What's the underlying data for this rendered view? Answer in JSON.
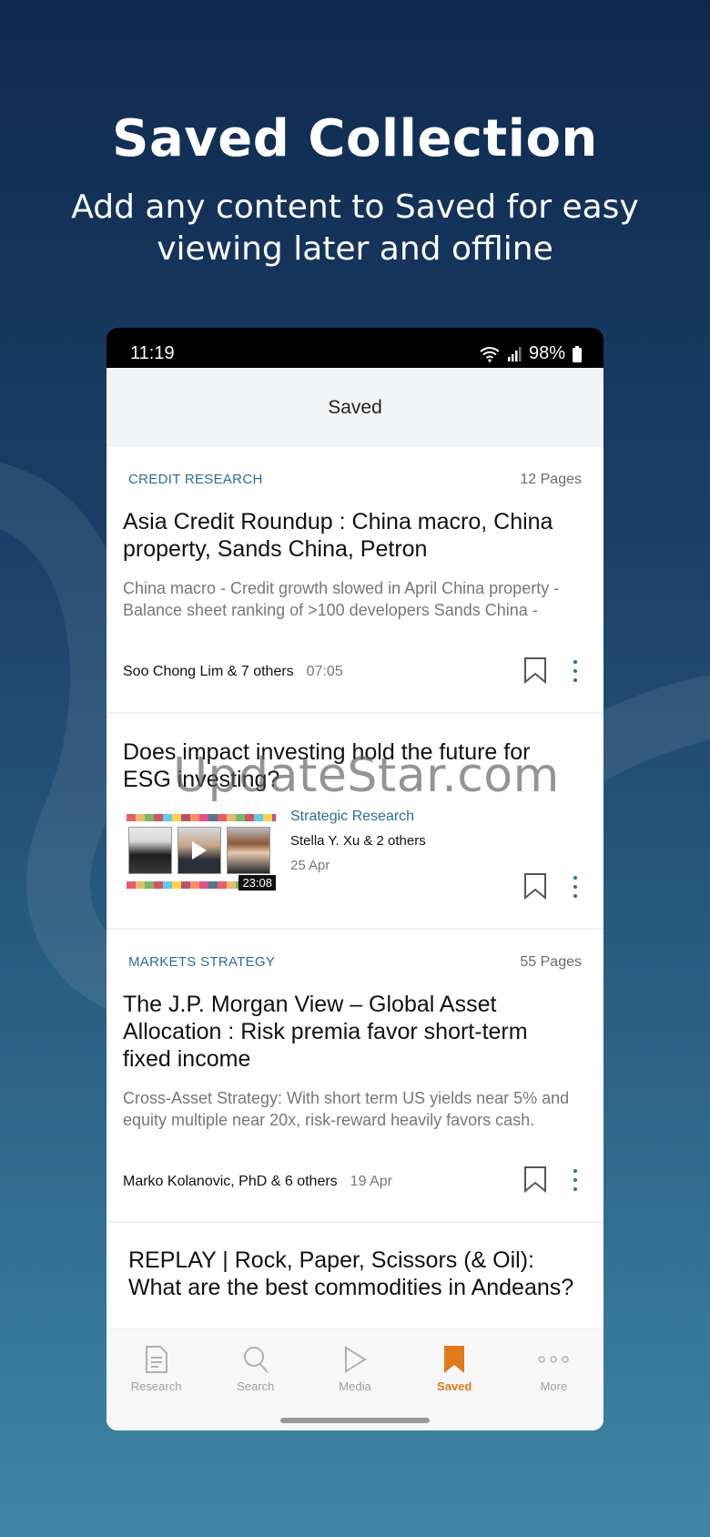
{
  "promo": {
    "title": "Saved Collection",
    "subtitle": "Add any content to Saved for easy viewing later and offline"
  },
  "status": {
    "time": "11:19",
    "battery": "98%"
  },
  "header": {
    "title": "Saved"
  },
  "items": [
    {
      "tag": "CREDIT RESEARCH",
      "pages": "12 Pages",
      "title": "Asia Credit Roundup : China macro, China property, Sands China, Petron",
      "excerpt": "China macro - Credit growth slowed in April China property - Balance sheet ranking of >100 developers Sands China -",
      "author": "Soo Chong Lim & 7 others",
      "date": "07:05"
    },
    {
      "title": "Does impact investing hold the future for ESG investing?",
      "category": "Strategic Research",
      "author": "Stella Y. Xu & 2 others",
      "date": "25 Apr",
      "duration": "23:08"
    },
    {
      "tag": "MARKETS STRATEGY",
      "pages": "55 Pages",
      "title": "The J.P. Morgan View – Global Asset Allocation : Risk premia favor short-term fixed income",
      "excerpt": "Cross-Asset Strategy: With short term US yields near 5% and equity multiple near 20x, risk-reward heavily favors cash.",
      "author": "Marko Kolanovic, PhD & 6 others",
      "date": "19 Apr"
    },
    {
      "title": "REPLAY | Rock, Paper, Scissors (& Oil): What are the best commodities in Andeans?"
    }
  ],
  "tabs": [
    {
      "label": "Research",
      "icon": "document-icon"
    },
    {
      "label": "Search",
      "icon": "search-icon"
    },
    {
      "label": "Media",
      "icon": "play-icon"
    },
    {
      "label": "Saved",
      "icon": "bookmark-icon",
      "active": true
    },
    {
      "label": "More",
      "icon": "more-dots-icon"
    }
  ],
  "watermark": "UpdateStar.com",
  "colors": {
    "accent": "#e07b1a",
    "link": "#2a6f8f"
  }
}
